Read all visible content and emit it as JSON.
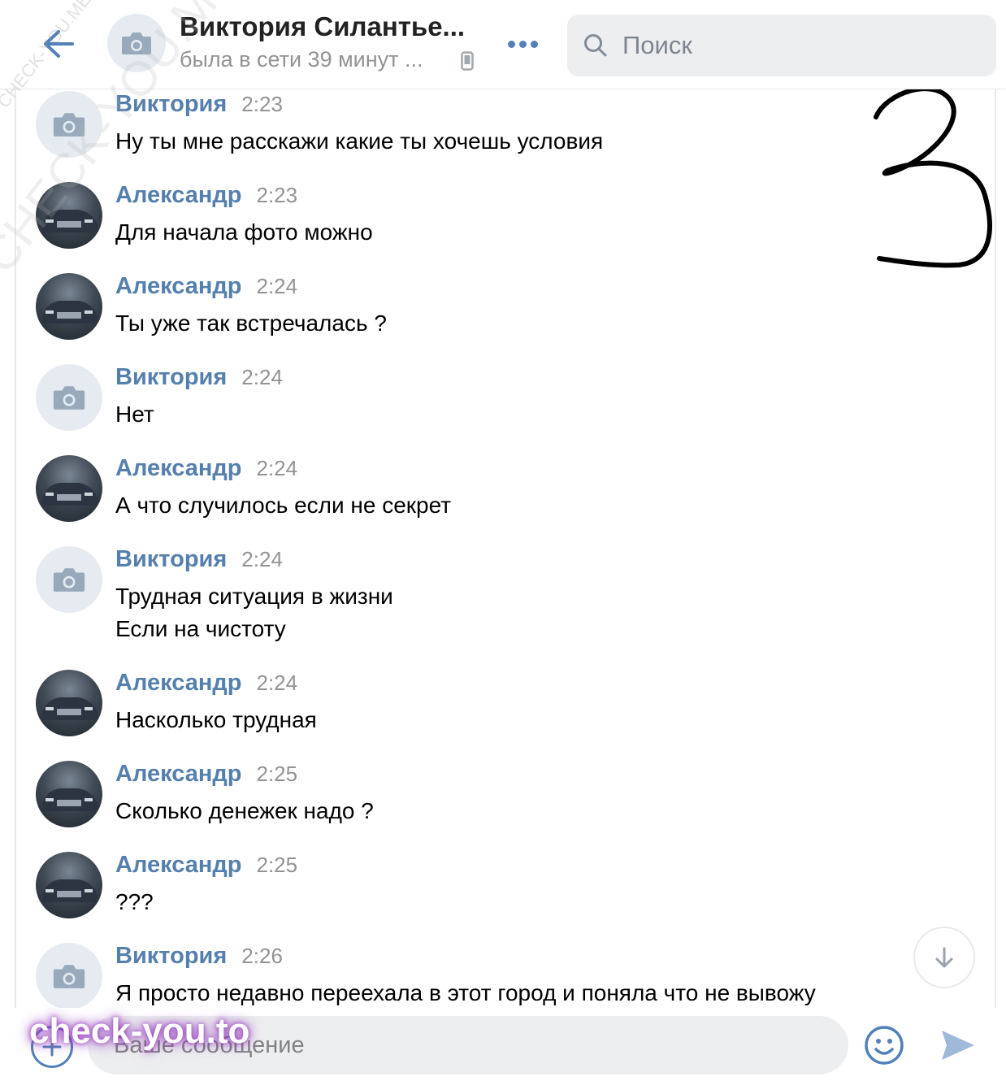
{
  "header": {
    "back_icon": "arrow-left-icon",
    "contact_name": "Виктория Силантье...",
    "status": "была в сети 39 минут ...",
    "device_icon": "mobile-phone-icon",
    "more_icon": "more-dots-icon",
    "search_placeholder": "Поиск"
  },
  "watermarks": {
    "small": "CHECK-YOU.ME",
    "large": "CHECK-YOU.ME",
    "brand": "check-you.to"
  },
  "annotation": {
    "handwritten_mark": "3"
  },
  "messages": [
    {
      "author": "Виктория",
      "time": "2:23",
      "lines": [
        "Ну ты мне расскажи какие ты хочешь условия"
      ]
    },
    {
      "author": "Александр",
      "time": "2:23",
      "lines": [
        "Для начала фото можно"
      ]
    },
    {
      "author": "Александр",
      "time": "2:24",
      "lines": [
        "Ты уже так встречалась ?"
      ]
    },
    {
      "author": "Виктория",
      "time": "2:24",
      "lines": [
        "Нет"
      ]
    },
    {
      "author": "Александр",
      "time": "2:24",
      "lines": [
        "А что случилось если не секрет"
      ]
    },
    {
      "author": "Виктория",
      "time": "2:24",
      "lines": [
        "Трудная ситуация в жизни",
        "Если на чистоту"
      ]
    },
    {
      "author": "Александр",
      "time": "2:24",
      "lines": [
        "Насколько трудная"
      ]
    },
    {
      "author": "Александр",
      "time": "2:25",
      "lines": [
        "Сколько денежек надо ?"
      ]
    },
    {
      "author": "Александр",
      "time": "2:25",
      "lines": [
        "???"
      ]
    },
    {
      "author": "Виктория",
      "time": "2:26",
      "lines": [
        "Я просто недавно переехала в этот город и поняла что не вывожу"
      ]
    }
  ],
  "composer": {
    "placeholder": "Ваше сообщение",
    "attach_icon": "plus-circle-icon",
    "emoji_icon": "smiley-icon",
    "send_icon": "send-arrow-icon"
  },
  "scroll_down_icon": "arrow-down-icon",
  "colors": {
    "accent": "#5181b8",
    "author": "#5580ad",
    "time": "#939393"
  }
}
